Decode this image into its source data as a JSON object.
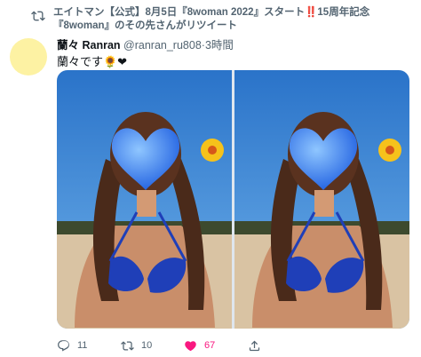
{
  "social_context": {
    "text": "エイトマン【公式】8月5日『8woman 2022』スタート‼️15周年記念『8woman』のその先さんがリツイート",
    "icon": "retweet-icon"
  },
  "tweet": {
    "author": {
      "display_name": "蘭々 Ranran",
      "handle": "@ranran_ru808",
      "separator": "·",
      "time": "3時間",
      "avatar_color": "#fdf2a3"
    },
    "text": "蘭々です🌻❤",
    "media": {
      "count": 2,
      "sky_color": "#2f7fd0",
      "heart_color": "#2f6fe8"
    },
    "actions": {
      "reply": {
        "icon": "reply-icon",
        "count": "11"
      },
      "retweet": {
        "icon": "retweet-icon",
        "count": "10"
      },
      "like": {
        "icon": "heart-icon",
        "count": "67",
        "liked": true,
        "color": "#f91880"
      },
      "share": {
        "icon": "share-icon"
      }
    }
  }
}
